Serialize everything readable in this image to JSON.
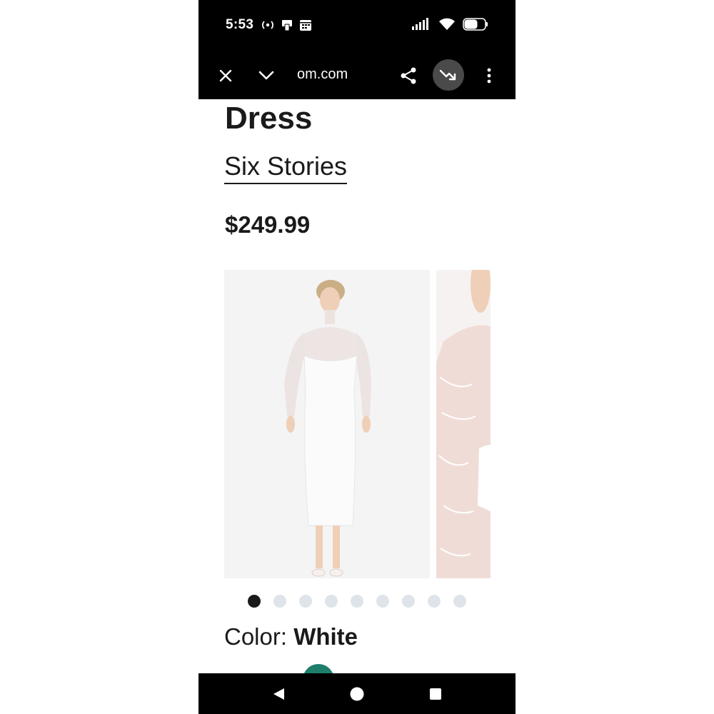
{
  "status_bar": {
    "time": "5:53"
  },
  "browser": {
    "url": "om.com"
  },
  "product": {
    "title": "Dress",
    "brand": "Six Stories",
    "price": "$249.99",
    "color_label": "Color: ",
    "color_value": "White"
  },
  "gallery": {
    "total_images": 9,
    "active_index": 0
  },
  "colors": {
    "accent_swatch": "#1d7f6a",
    "bar_bg": "#000000",
    "text": "#1a1a1a"
  }
}
